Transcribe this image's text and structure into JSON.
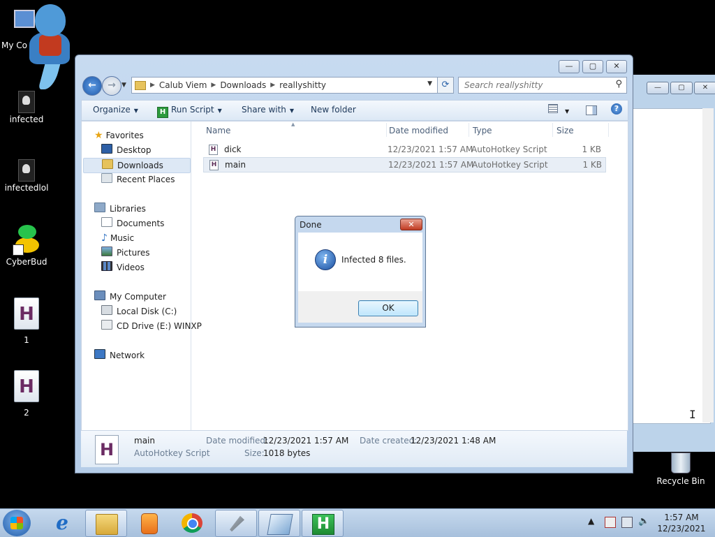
{
  "desktop": {
    "icons": [
      {
        "label": "My Computer",
        "visible_label": "My Co"
      },
      {
        "label": "infected"
      },
      {
        "label": "infectedlol"
      },
      {
        "label": "CyberBud"
      },
      {
        "label": "1"
      },
      {
        "label": "2"
      },
      {
        "label": "Recycle Bin"
      }
    ]
  },
  "explorer": {
    "breadcrumb": [
      "Calub Viem",
      "Downloads",
      "reallyshitty"
    ],
    "search_placeholder": "Search reallyshitty",
    "toolbar": {
      "organize": "Organize",
      "run_script": "Run Script",
      "share_with": "Share with",
      "new_folder": "New folder"
    },
    "nav": {
      "favorites": "Favorites",
      "desktop": "Desktop",
      "downloads": "Downloads",
      "recent_places": "Recent Places",
      "libraries": "Libraries",
      "documents": "Documents",
      "music": "Music",
      "pictures": "Pictures",
      "videos": "Videos",
      "my_computer": "My Computer",
      "local_disk": "Local Disk (C:)",
      "cd_drive": "CD Drive (E:) WINXP",
      "network": "Network"
    },
    "columns": {
      "name": "Name",
      "date_modified": "Date modified",
      "type": "Type",
      "size": "Size"
    },
    "files": [
      {
        "name": "dick",
        "date_modified": "12/23/2021 1:57 AM",
        "type": "AutoHotkey Script",
        "size": "1 KB"
      },
      {
        "name": "main",
        "date_modified": "12/23/2021 1:57 AM",
        "type": "AutoHotkey Script",
        "size": "1 KB"
      }
    ],
    "details": {
      "name": "main",
      "type": "AutoHotkey Script",
      "date_modified_label": "Date modified:",
      "date_modified": "12/23/2021 1:57 AM",
      "date_created_label": "Date created:",
      "date_created": "12/23/2021 1:48 AM",
      "size_label": "Size:",
      "size": "1018 bytes"
    }
  },
  "dialog": {
    "title": "Done",
    "message": "Infected 8 files.",
    "ok": "OK"
  },
  "taskbar": {
    "time": "1:57 AM",
    "date": "12/23/2021"
  },
  "icons": {
    "back": "back-arrow-icon",
    "forward": "forward-arrow-icon",
    "search": "magnifier-icon",
    "info": "info-icon"
  }
}
